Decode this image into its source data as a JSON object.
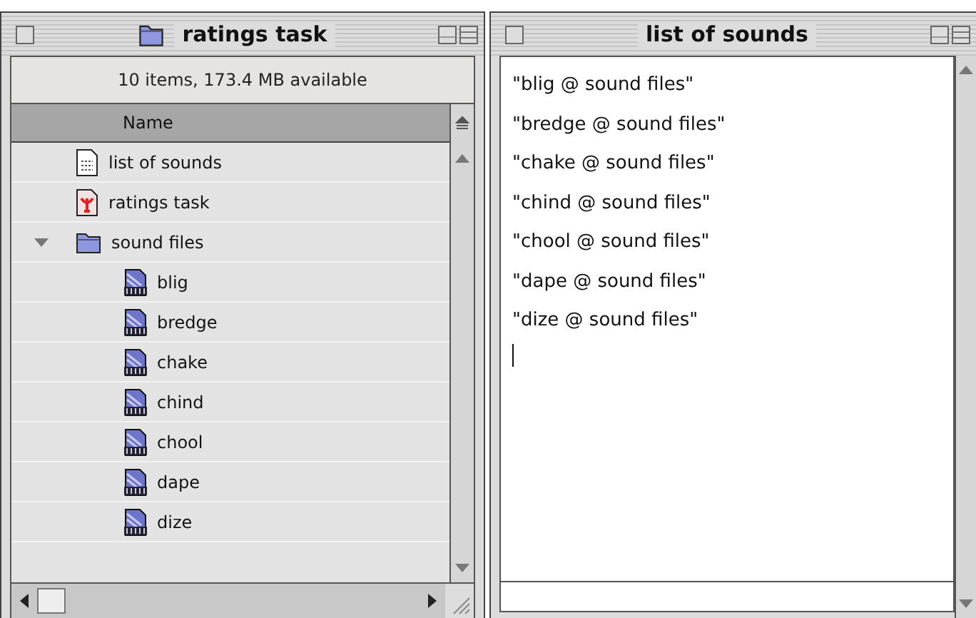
{
  "finder_window": {
    "title": "ratings task",
    "info": "10 items, 173.4 MB available",
    "column": "Name",
    "items": [
      {
        "name": "list of sounds",
        "kind": "document"
      },
      {
        "name": "ratings task",
        "kind": "application"
      },
      {
        "name": "sound files",
        "kind": "folder",
        "expanded": true,
        "children": [
          {
            "name": "blig",
            "kind": "sound"
          },
          {
            "name": "bredge",
            "kind": "sound"
          },
          {
            "name": "chake",
            "kind": "sound"
          },
          {
            "name": "chind",
            "kind": "sound"
          },
          {
            "name": "chool",
            "kind": "sound"
          },
          {
            "name": "dape",
            "kind": "sound"
          },
          {
            "name": "dize",
            "kind": "sound"
          }
        ]
      }
    ]
  },
  "text_window": {
    "title": "list of sounds",
    "lines": [
      "\"blig @ sound files\"",
      "\"bredge @ sound files\"",
      "\"chake @ sound files\"",
      "\"chind @ sound files\"",
      "\"chool @ sound files\"",
      "\"dape @ sound files\"",
      "\"dize @ sound files\""
    ]
  }
}
